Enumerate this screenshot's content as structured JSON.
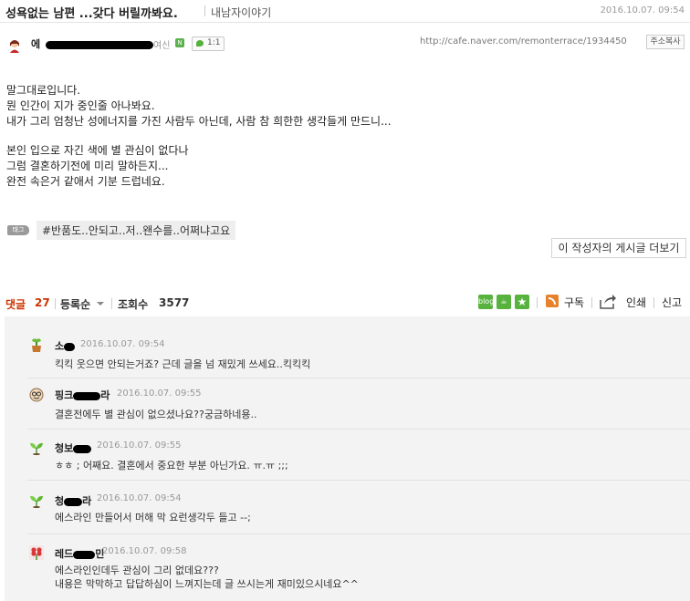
{
  "post": {
    "title": "성욕없는 남편 ...갖다 버릴까봐요.",
    "category": "내남자이야기",
    "date": "2016.10.07. 09:54",
    "author": {
      "name_visible_prefix": "에",
      "name_visible_suffix": "여신",
      "rank_icon": "cafe-member-icon",
      "chat_count": "1:1"
    },
    "url": "http://cafe.naver.com/remonterrace/1934450",
    "copy_url_label": "주소복사",
    "body_lines": [
      "말그대로입니다.",
      "뭔 인간이 지가 중인줄 아나봐요.",
      "내가 그리 엄청난 성에너지를 가진 사람두 아닌데, 사람 참 희한한 생각들게 만드니...",
      "",
      "본인 입으로 자긴 색에 별 관심이 없다나",
      "그럼 결혼하기전에 미리 말하든지...",
      "완전 속은거 같애서 기분 드럽네요."
    ],
    "tag_icon_label": "태그",
    "tag": "#반품도..안되고..저..왠수를..어쩌냐고요",
    "more_posts_label": "이 작성자의 게시글 더보기"
  },
  "comments_header": {
    "label": "댓글",
    "count": "27",
    "sort_label": "등록순",
    "views_label": "조회수",
    "views_count": "3577",
    "share_icons": [
      "blog-share-icon",
      "cafe-share-icon",
      "bookmark-star-icon"
    ],
    "subscribe_label": "구독",
    "print_label": "인쇄",
    "report_label": "신고",
    "colors": {
      "count": "#cc3300"
    }
  },
  "comments": [
    {
      "name": "소",
      "date": "2016.10.07. 09:54",
      "text": [
        "킥킥 웃으면 안되는거죠? 근데 글을 넘 재밌게 쓰세요..킥킥킥"
      ],
      "avatar": "flowerpot-icon"
    },
    {
      "name": "핑크",
      "name_tail": "라",
      "date": "2016.10.07. 09:55",
      "text": [
        "결혼전에두 별 관심이 없으셨나요??궁금하네용.."
      ],
      "avatar": "glasses-face-icon"
    },
    {
      "name": "청보",
      "date": "2016.10.07. 09:55",
      "text": [
        "ㅎㅎ ; 어째요. 결혼에서 중요한 부분 아닌가요. ㅠ.ㅠ ;;;"
      ],
      "avatar": "sprout-icon"
    },
    {
      "name": "청",
      "name_tail": "라",
      "date": "2016.10.07. 09:54",
      "text": [
        "에스라인 만들어서 머해 막 요런생각두 들고 --;"
      ],
      "avatar": "sprout-icon"
    },
    {
      "name": "레드",
      "name_tail": "민",
      "date": "2016.10.07. 09:58",
      "text": [
        "에스라인인데두 관심이 그리 없데요???",
        "내용은 막막하고 답답하심이 느껴지는데 글 쓰시는게 재미있으시네요^^"
      ],
      "avatar": "flower-icon"
    }
  ]
}
